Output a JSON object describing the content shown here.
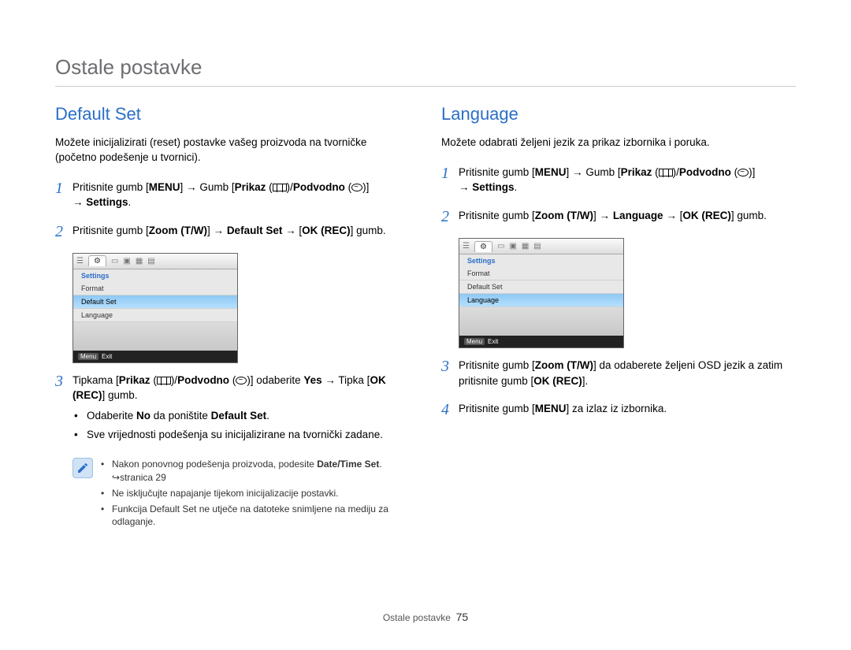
{
  "page": {
    "title": "Ostale postavke",
    "footer_label": "Ostale postavke",
    "page_number": "75"
  },
  "left": {
    "heading": "Default Set",
    "intro": "Možete inicijalizirati (reset) postavke vašeg proizvoda na tvorničke (početno podešenje u tvornici).",
    "step1_a": "Pritisnite gumb [",
    "step1_menu": "MENU",
    "step1_b": "] ",
    "step1_c": " Gumb [",
    "step1_prikaz": "Prikaz",
    "step1_d": " (",
    "step1_e": ")/",
    "step1_podvodno": "Podvodno",
    "step1_f": " (",
    "step1_g": ")] ",
    "step1_settings": "Settings",
    "step1_end": ".",
    "step2_a": "Pritisnite gumb [",
    "step2_zoom": "Zoom (T/W)",
    "step2_b": "] ",
    "step2_default": "Default Set",
    "step2_c": " ",
    "step2_okrec": "OK (REC)",
    "step2_d": "] gumb.",
    "step3_a": "Tipkama [",
    "step3_prikaz": "Prikaz",
    "step3_b": " (",
    "step3_c": ")/",
    "step3_podvodno": "Podvodno",
    "step3_d": " (",
    "step3_e": ")] odaberite ",
    "step3_yes": "Yes",
    "step3_f": " ",
    "step3_g": " Tipka [",
    "step3_okrec": "OK (REC)",
    "step3_h": "] gumb.",
    "sub1_a": "Odaberite ",
    "sub1_no": "No",
    "sub1_b": " da poništite ",
    "sub1_default": "Default Set",
    "sub1_c": ".",
    "sub2": "Sve vrijednosti podešenja su inicijalizirane na tvornički zadane.",
    "note1_a": "Nakon ponovnog podešenja proizvoda, podesite ",
    "note1_b": "Date/Time Set",
    "note1_c": ". ",
    "note1_page": "stranica 29",
    "note2": "Ne isključujte napajanje tijekom inicijalizacije postavki.",
    "note3": "Funkcija Default Set ne utječe na datoteke snimljene na mediju za odlaganje."
  },
  "right": {
    "heading": "Language",
    "intro": "Možete odabrati željeni jezik za prikaz izbornika i poruka.",
    "step1_a": "Pritisnite gumb [",
    "step1_menu": "MENU",
    "step1_b": "] ",
    "step1_c": " Gumb [",
    "step1_prikaz": "Prikaz",
    "step1_d": " (",
    "step1_e": ")/",
    "step1_podvodno": "Podvodno",
    "step1_f": " (",
    "step1_g": ")] ",
    "step1_settings": "Settings",
    "step1_end": ".",
    "step2_a": "Pritisnite gumb [",
    "step2_zoom": "Zoom (T/W)",
    "step2_b": "] ",
    "step2_language": "Language",
    "step2_c": " ",
    "step2_okrec": "OK (REC)",
    "step2_d": "] gumb.",
    "step3_a": "Pritisnite gumb [",
    "step3_zoom": "Zoom (T/W)",
    "step3_b": "] da odaberete željeni OSD jezik a zatim pritisnite gumb [",
    "step3_okrec": "OK (REC)",
    "step3_c": "].",
    "step4_a": "Pritisnite gumb [",
    "step4_menu": "MENU",
    "step4_b": "] za izlaz iz izbornika."
  },
  "lcd": {
    "header": "Settings",
    "items": [
      "Format",
      "Default Set",
      "Language"
    ],
    "footer_menu": "Menu",
    "footer_exit": "Exit"
  },
  "step_numbers": {
    "n1": "1",
    "n2": "2",
    "n3": "3",
    "n4": "4"
  }
}
